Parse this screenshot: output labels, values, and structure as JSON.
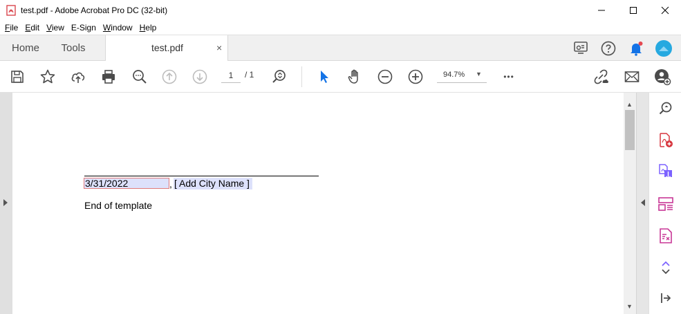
{
  "window": {
    "title": "test.pdf - Adobe Acrobat Pro DC (32-bit)",
    "minimize_icon": "minimize-icon",
    "maximize_icon": "maximize-icon",
    "close_icon": "close-icon"
  },
  "menu": {
    "items": [
      {
        "first": "F",
        "rest": "ile"
      },
      {
        "first": "E",
        "rest": "dit"
      },
      {
        "first": "V",
        "rest": "iew"
      },
      {
        "first": "",
        "rest": "E-Sign"
      },
      {
        "first": "W",
        "rest": "indow"
      },
      {
        "first": "H",
        "rest": "elp"
      }
    ]
  },
  "tabs": {
    "home": "Home",
    "tools": "Tools",
    "document": "test.pdf",
    "close_glyph": "×"
  },
  "toolbar": {
    "current_page": "1",
    "page_total": "/  1",
    "zoom": "94.7%",
    "zoom_caret": "▼",
    "more": "•••"
  },
  "document": {
    "date_value": "3/31/2022",
    "comma": ",",
    "city_placeholder": "[ Add City Name ]",
    "end_text": "End of template"
  },
  "scrollbar": {
    "up": "▲",
    "down": "▼"
  },
  "colors": {
    "accent_blue": "#1473e6",
    "pdf_red": "#d7373f",
    "purple": "#7b61ff",
    "magenta": "#c83696",
    "field_fill": "#dde1fb"
  }
}
